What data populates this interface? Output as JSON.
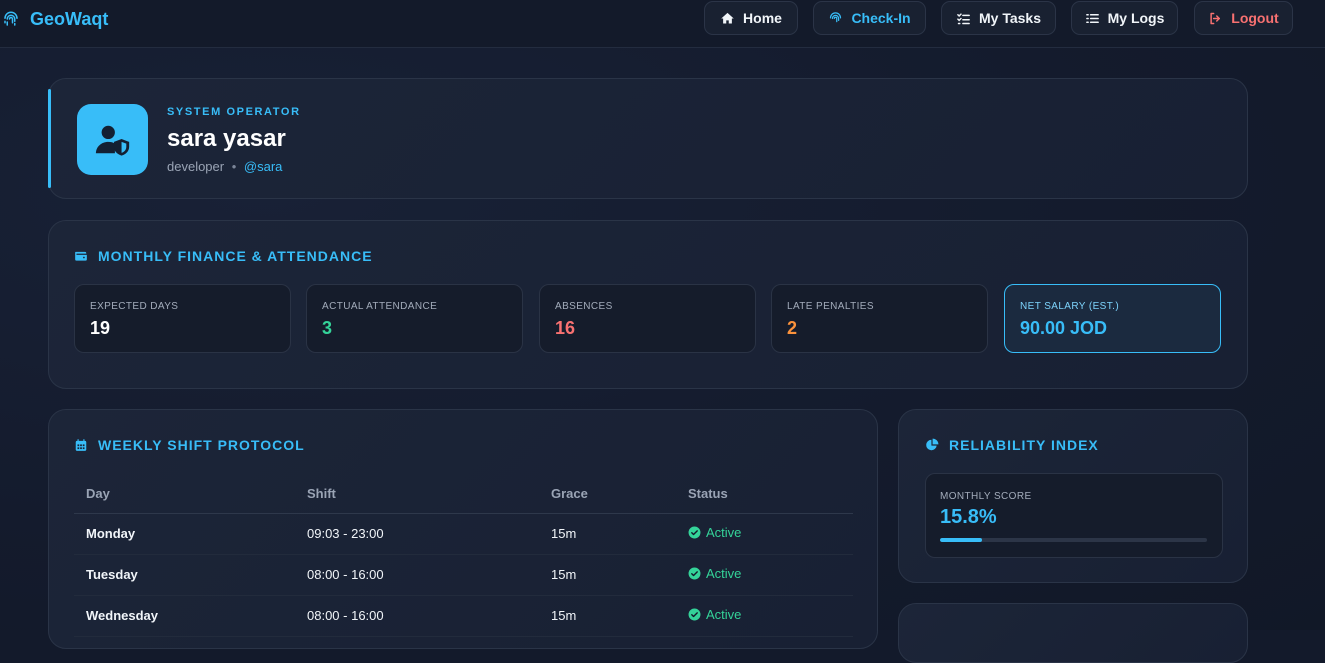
{
  "brand": {
    "name": "GeoWaqt"
  },
  "nav": [
    {
      "label": "Home",
      "icon": "home-icon"
    },
    {
      "label": "Check-In",
      "icon": "fingerprint-icon"
    },
    {
      "label": "My Tasks",
      "icon": "tasks-icon"
    },
    {
      "label": "My Logs",
      "icon": "list-icon"
    },
    {
      "label": "Logout",
      "icon": "logout-icon"
    }
  ],
  "profile": {
    "role": "SYSTEM OPERATOR",
    "name": "sara yasar",
    "title": "developer",
    "separator": "•",
    "handle": "@sara"
  },
  "finance": {
    "title": "MONTHLY FINANCE & ATTENDANCE",
    "stats": [
      {
        "label": "Expected Days",
        "value": "19",
        "color": "#ffffff"
      },
      {
        "label": "Actual Attendance",
        "value": "3",
        "color": "#34d399"
      },
      {
        "label": "Absences",
        "value": "16",
        "color": "#f87171"
      },
      {
        "label": "Late Penalties",
        "value": "2",
        "color": "#fb923c"
      },
      {
        "label": "Net Salary (Est.)",
        "value": "90.00 JOD",
        "color": "#38bdf8"
      }
    ]
  },
  "shifts": {
    "title": "WEEKLY SHIFT PROTOCOL",
    "columns": [
      "Day",
      "Shift",
      "Grace",
      "Status"
    ],
    "rows": [
      {
        "day": "Monday",
        "shift": "09:03 - 23:00",
        "grace": "15m",
        "status": "Active"
      },
      {
        "day": "Tuesday",
        "shift": "08:00 - 16:00",
        "grace": "15m",
        "status": "Active"
      },
      {
        "day": "Wednesday",
        "shift": "08:00 - 16:00",
        "grace": "15m",
        "status": "Active"
      }
    ]
  },
  "reliability": {
    "title": "RELIABILITY INDEX",
    "label": "MONTHLY SCORE",
    "value": "15.8%",
    "percent": 15.8
  },
  "colors": {
    "accent": "#38bdf8",
    "success": "#34d399",
    "danger": "#f87171",
    "warning": "#fb923c"
  }
}
